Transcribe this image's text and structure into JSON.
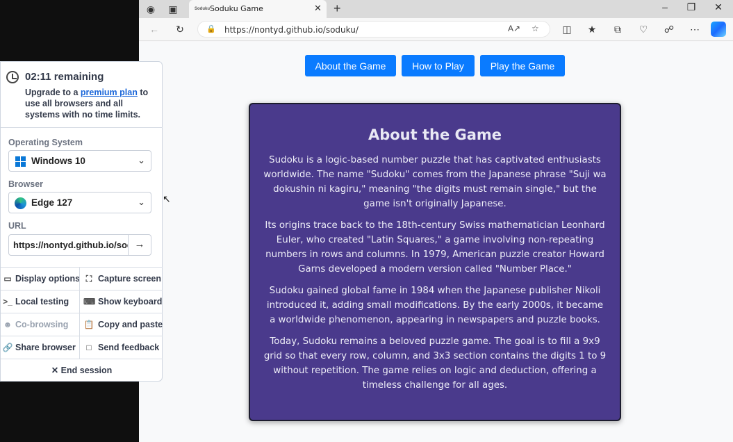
{
  "browser": {
    "tab_title": "Soduku Game",
    "tab_favicon_text": "Soduku",
    "url": "https://nontyd.github.io/soduku/"
  },
  "page": {
    "nav": [
      "About the Game",
      "How to Play",
      "Play the Game"
    ],
    "card": {
      "title": "About the Game",
      "paragraphs": [
        "Sudoku is a logic-based number puzzle that has captivated enthusiasts worldwide. The name \"Sudoku\" comes from the Japanese phrase \"Suji wa dokushin ni kagiru,\" meaning \"the digits must remain single,\" but the game isn't originally Japanese.",
        "Its origins trace back to the 18th-century Swiss mathematician Leonhard Euler, who created \"Latin Squares,\" a game involving non-repeating numbers in rows and columns. In 1979, American puzzle creator Howard Garns developed a modern version called \"Number Place.\"",
        "Sudoku gained global fame in 1984 when the Japanese publisher Nikoli introduced it, adding small modifications. By the early 2000s, it became a worldwide phenomenon, appearing in newspapers and puzzle books.",
        "Today, Sudoku remains a beloved puzzle game. The goal is to fill a 9x9 grid so that every row, column, and 3x3 section contains the digits 1 to 9 without repetition. The game relies on logic and deduction, offering a timeless challenge for all ages."
      ]
    }
  },
  "panel": {
    "timer": "02:11 remaining",
    "upgrade_prefix": "Upgrade to a ",
    "upgrade_link": "premium plan",
    "upgrade_suffix": " to use all browsers and all systems with no time limits.",
    "os_label": "Operating System",
    "os_value": "Windows 10",
    "browser_label": "Browser",
    "browser_value": "Edge 127",
    "url_label": "URL",
    "url_value": "https://nontyd.github.io/soduku/",
    "actions": [
      {
        "label": "Display options",
        "icon": "monitor-icon"
      },
      {
        "label": "Capture screen",
        "icon": "capture-icon"
      },
      {
        "label": "Local testing",
        "icon": "terminal-icon"
      },
      {
        "label": "Show keyboard",
        "icon": "keyboard-icon"
      },
      {
        "label": "Co-browsing",
        "icon": "users-icon"
      },
      {
        "label": "Copy and paste",
        "icon": "clipboard-icon"
      },
      {
        "label": "Share browser",
        "icon": "link-icon"
      },
      {
        "label": "Send feedback",
        "icon": "feedback-icon"
      }
    ],
    "end_session": "End session"
  },
  "colors": {
    "nav_button": "#0a7bff",
    "card_bg": "#4a3a8c",
    "link": "#1a66d9"
  }
}
